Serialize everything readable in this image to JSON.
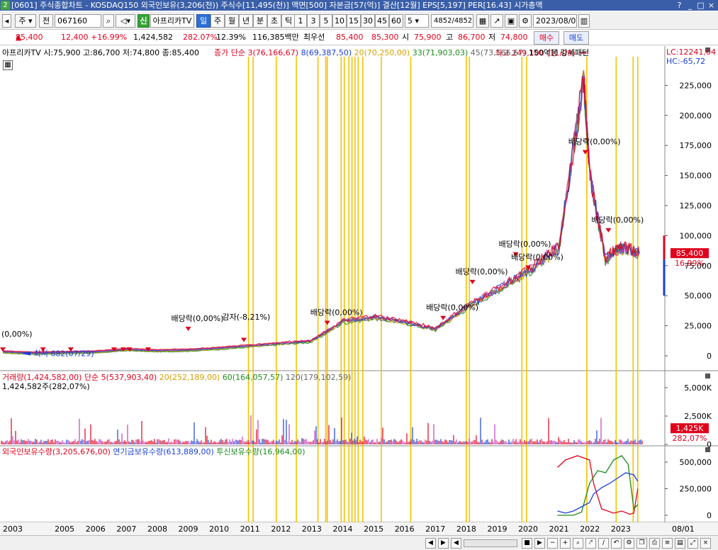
{
  "window": {
    "title": "[0601] 주식종합차트 - KOSDAQ150 외국인보유(3,206(천)) 주식수[11,495(천)] 액면[500] 자본금[57(억)] 결산[12월] EPS[5,197] PER[16.43] 시가총액",
    "app_number": "2",
    "controls": [
      "?",
      "_",
      "□",
      "×"
    ]
  },
  "toolbar": {
    "period_mode": "주",
    "prev_label": "전",
    "code": "067160",
    "new_label": "신",
    "stock_name": "아프리카TV",
    "period_tabs": [
      "일",
      "주",
      "월",
      "년",
      "분",
      "초",
      "틱"
    ],
    "active_period": "일",
    "intervals": [
      "1",
      "3",
      "5",
      "10",
      "15",
      "30",
      "45",
      "60"
    ],
    "interval_value": "5",
    "count": "4852",
    "total": "/4852",
    "date": "2023/08/01"
  },
  "quote": {
    "price": "85,400",
    "change": "12,400",
    "change_pct": "+16.99%",
    "volume": "1,424,582",
    "volume_ratio": "282.07%",
    "turnover": "12.39%",
    "amount": "116,385백만",
    "priority_label": "최우선",
    "ask": "85,400",
    "bid": "85,300",
    "open_label": "시",
    "open": "75,900",
    "high_label": "고",
    "high": "86,700",
    "low_label": "저",
    "low": "74,800",
    "buy_label": "매수",
    "sell_label": "매도"
  },
  "price_panel": {
    "header": "아프리카TV 시:75,900 고:86,700 저:74,800 종:85,400",
    "ma_label": "종가 단순",
    "ma": [
      {
        "label": "3(76,166,67)",
        "color": "#e0001c"
      },
      {
        "label": "8(69,387,50)",
        "color": "#1a3fd6"
      },
      {
        "label": "20(70,250,00)",
        "color": "#d4a000"
      },
      {
        "label": "33(71,903,03)",
        "color": "#1a8a1a"
      },
      {
        "label": "45(73,566,67)",
        "color": "#666666"
      }
    ],
    "signal": "150억봉 강세패턴",
    "lc": "LC:12241,04",
    "hc": "HC:-65,72",
    "y_ticks": [
      "225,000",
      "200,000",
      "175,000",
      "150,000",
      "125,000",
      "100,000",
      "75,000",
      "50,000",
      "25,000",
      "0"
    ],
    "current_price_tag": "85,400",
    "current_pct_tag": "16,99%",
    "annotations": [
      {
        "text": "최고 249,100 (11/09)"
      },
      {
        "text": "배당락(0,00%)"
      },
      {
        "text": "배당락(0,00%)"
      },
      {
        "text": "배당락(0,00%)"
      },
      {
        "text": "배당락(0,00%)"
      },
      {
        "text": "배당락(0,00%)"
      },
      {
        "text": "배당락(0,00%)"
      },
      {
        "text": "배당락(0,00%)"
      },
      {
        "text": "배당락(0,00%)"
      },
      {
        "text": "감자(-8,21%)"
      },
      {
        "text": "최저 682(07/29)"
      },
      {
        "text": "(0,00%)"
      }
    ]
  },
  "volume_panel": {
    "label": "거래량(1,424,582,00)",
    "ma_label": "단순",
    "ma": [
      {
        "label": "5(537,903,40)",
        "color": "#e0001c"
      },
      {
        "label": "20(252,189,00)",
        "color": "#d4a000"
      },
      {
        "label": "60(164,057,57)",
        "color": "#1a8a1a"
      },
      {
        "label": "120(179,102,59)",
        "color": "#666666"
      }
    ],
    "sub_label": "1,424,582주(282,07%)",
    "y_ticks": [
      "5,000K",
      "2,500K",
      "0"
    ],
    "current_tag": "1,425K",
    "current_pct": "282,07%"
  },
  "holding_panel": {
    "series": [
      {
        "label": "외국인보유수량(3,205,676,00)",
        "color": "#e0001c"
      },
      {
        "label": "연기금보유수량(613,889,00)",
        "color": "#1a3fd6"
      },
      {
        "label": "투신보유수량(16,964,00)",
        "color": "#1a8a1a"
      }
    ],
    "y_ticks": [
      "500,000",
      "250,000",
      "0"
    ]
  },
  "x_axis": {
    "years": [
      "2003",
      "2005",
      "2006",
      "2007",
      "2008",
      "2009",
      "2010",
      "2011",
      "2012",
      "2013",
      "2014",
      "2015",
      "2016",
      "2017",
      "2018",
      "2019",
      "2020",
      "2021",
      "2022",
      "2023"
    ],
    "end_label": "08/01"
  },
  "chart_data": {
    "type": "line",
    "title": "",
    "xlabel": "",
    "ylabel": "",
    "ylim": [
      0,
      240000
    ],
    "x": [
      2003,
      2004,
      2005,
      2006,
      2007,
      2008,
      2009,
      2010,
      2011,
      2012,
      2013,
      2014,
      2015,
      2016,
      2017,
      2018,
      2019,
      2020,
      2021,
      2021.8,
      2022,
      2022.5,
      2023,
      2023.6
    ],
    "series": [
      {
        "values": [
          3000,
          2000,
          2500,
          3000,
          5000,
          4000,
          4500,
          6000,
          8000,
          10000,
          12000,
          28000,
          32000,
          28000,
          22000,
          40000,
          55000,
          70000,
          90000,
          230000,
          150000,
          80000,
          90000,
          85400
        ]
      }
    ]
  },
  "bottombar": {
    "buttons": [
      "◀",
      "▶",
      "◀",
      "■",
      "▶",
      "−",
      "+",
      "⌕"
    ]
  }
}
